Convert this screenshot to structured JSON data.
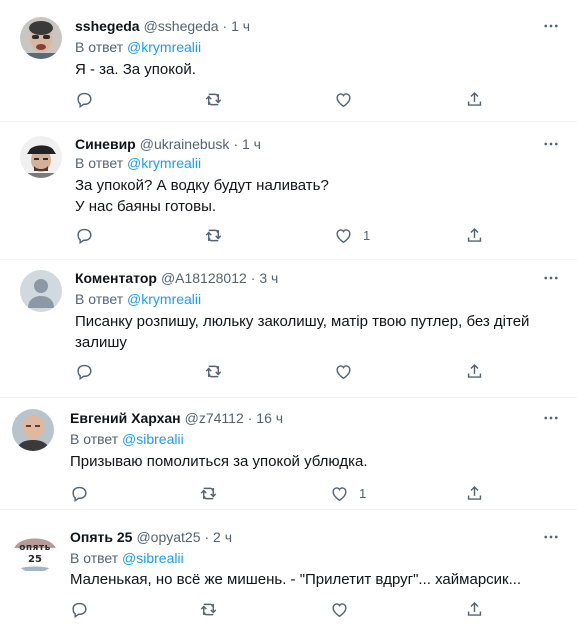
{
  "tweets": [
    {
      "name": "sshegeda",
      "handle": "@sshegeda",
      "time": "· 1 ч",
      "reply_label": "В ответ",
      "reply_to": "@krymrealii",
      "lines": [
        "Я - за. За упокой."
      ],
      "likes": "",
      "avatar": "photo"
    },
    {
      "name": "Синевир",
      "handle": "@ukrainebusk",
      "time": "· 1 ч",
      "reply_label": "В ответ",
      "reply_to": "@krymrealii",
      "lines": [
        "За упокой? А водку будут наливать?",
        "У нас баяны готовы."
      ],
      "likes": "1",
      "avatar": "photo"
    },
    {
      "name": "Коментатор",
      "handle": "@A18128012",
      "time": "· 3 ч",
      "reply_label": "В ответ",
      "reply_to": "@krymrealii",
      "lines": [
        "Писанку розпишу, люльку заколишу, матір твою путлер, без дітей",
        "залишу"
      ],
      "likes": "",
      "avatar": "default"
    },
    {
      "name": "Евгений Хархан",
      "handle": "@z74112",
      "time": "· 16 ч",
      "reply_label": "В ответ",
      "reply_to": "@sibrealii",
      "lines": [
        "Призываю помолиться за упокой ублюдка."
      ],
      "likes": "1",
      "avatar": "photo"
    },
    {
      "name": "Опять 25",
      "handle": "@opyat25",
      "time": "· 2 ч",
      "reply_label": "В ответ",
      "reply_to": "@sibrealii",
      "lines": [
        "Маленькая, но всё же мишень. - \"Прилетит вдруг\"... хаймарсик..."
      ],
      "likes": "",
      "avatar": "logo",
      "avatar_text": [
        "опять",
        "25"
      ]
    }
  ],
  "icons": {
    "reply": "reply-icon",
    "retweet": "retweet-icon",
    "like": "like-icon",
    "share": "share-icon",
    "more": "more-icon"
  },
  "colors": {
    "link": "#1d9bf0",
    "secondary": "#536471",
    "text": "#0f1419"
  }
}
